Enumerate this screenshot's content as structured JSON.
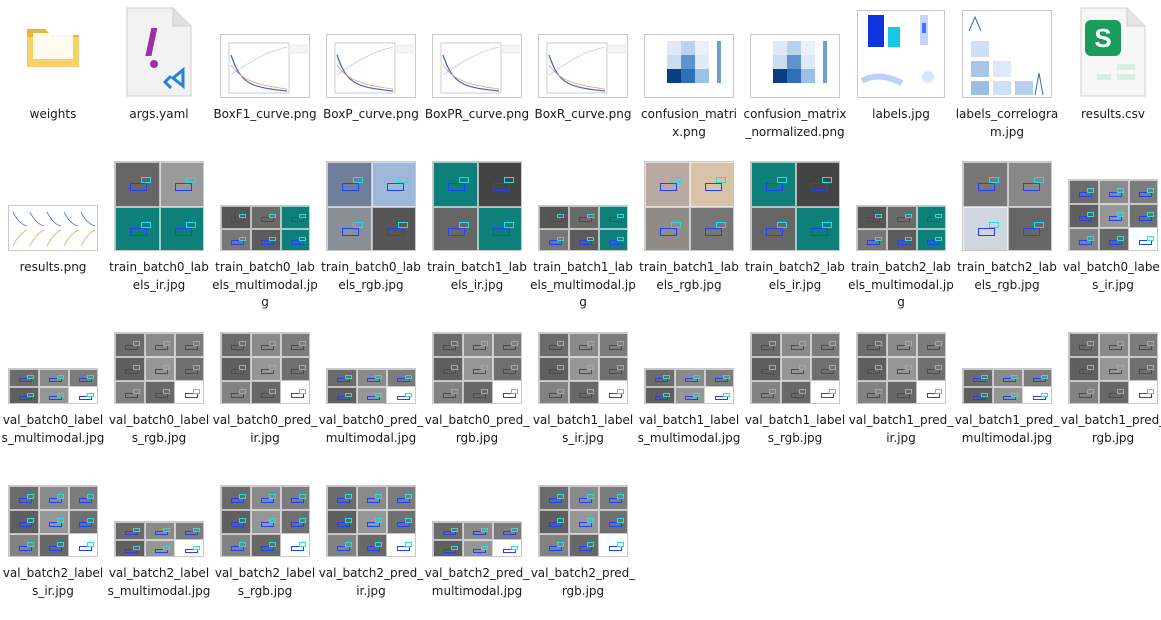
{
  "files": [
    {
      "name": "weights",
      "kind": "folder"
    },
    {
      "name": "args.yaml",
      "kind": "yaml"
    },
    {
      "name": "BoxF1_curve.png",
      "kind": "curve"
    },
    {
      "name": "BoxP_curve.png",
      "kind": "curve"
    },
    {
      "name": "BoxPR_curve.png",
      "kind": "curve"
    },
    {
      "name": "BoxR_curve.png",
      "kind": "curve"
    },
    {
      "name": "confusion_matrix.png",
      "kind": "matrix"
    },
    {
      "name": "confusion_matrix_normalized.png",
      "kind": "matrix"
    },
    {
      "name": "labels.jpg",
      "kind": "labels"
    },
    {
      "name": "labels_correlogram.jpg",
      "kind": "correlogram"
    },
    {
      "name": "results.csv",
      "kind": "csv"
    },
    {
      "name": "results.png",
      "kind": "results"
    },
    {
      "name": "train_batch0_labels_ir.jpg",
      "kind": "train_ir"
    },
    {
      "name": "train_batch0_labels_multimodal.jpg",
      "kind": "train_multi"
    },
    {
      "name": "train_batch0_labels_rgb.jpg",
      "kind": "train_rgb"
    },
    {
      "name": "train_batch1_labels_ir.jpg",
      "kind": "train_ir2"
    },
    {
      "name": "train_batch1_labels_multimodal.jpg",
      "kind": "train_multi"
    },
    {
      "name": "train_batch1_labels_rgb.jpg",
      "kind": "train_rgb2"
    },
    {
      "name": "train_batch2_labels_ir.jpg",
      "kind": "train_ir2"
    },
    {
      "name": "train_batch2_labels_multimodal.jpg",
      "kind": "train_multi"
    },
    {
      "name": "train_batch2_labels_rgb.jpg",
      "kind": "train_rgb3"
    },
    {
      "name": "val_batch0_labels_ir.jpg",
      "kind": "val"
    },
    {
      "name": "val_batch0_labels_multimodal.jpg",
      "kind": "val_multi"
    },
    {
      "name": "val_batch0_labels_rgb.jpg",
      "kind": "val"
    },
    {
      "name": "val_batch0_pred_ir.jpg",
      "kind": "val"
    },
    {
      "name": "val_batch0_pred_multimodal.jpg",
      "kind": "val_multi"
    },
    {
      "name": "val_batch0_pred_rgb.jpg",
      "kind": "val"
    },
    {
      "name": "val_batch1_labels_ir.jpg",
      "kind": "val"
    },
    {
      "name": "val_batch1_labels_multimodal.jpg",
      "kind": "val_multi"
    },
    {
      "name": "val_batch1_labels_rgb.jpg",
      "kind": "val"
    },
    {
      "name": "val_batch1_pred_ir.jpg",
      "kind": "val"
    },
    {
      "name": "val_batch1_pred_multimodal.jpg",
      "kind": "val_multi"
    },
    {
      "name": "val_batch1_pred_rgb.jpg",
      "kind": "val"
    },
    {
      "name": "val_batch2_labels_ir.jpg",
      "kind": "val"
    },
    {
      "name": "val_batch2_labels_multimodal.jpg",
      "kind": "val_multi"
    },
    {
      "name": "val_batch2_labels_rgb.jpg",
      "kind": "val"
    },
    {
      "name": "val_batch2_pred_ir.jpg",
      "kind": "val"
    },
    {
      "name": "val_batch2_pred_multimodal.jpg",
      "kind": "val_multi"
    },
    {
      "name": "val_batch2_pred_rgb.jpg",
      "kind": "val"
    }
  ]
}
